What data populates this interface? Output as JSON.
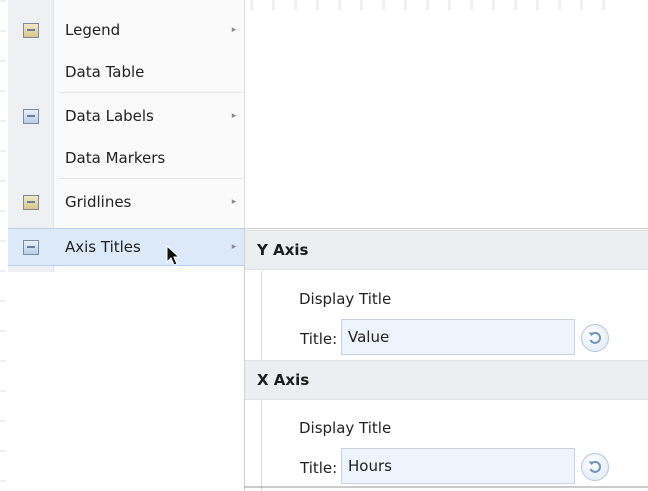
{
  "menu": {
    "items": [
      {
        "label": "Legend",
        "icon": "legend-icon",
        "has_submenu": true
      },
      {
        "label": "Data Table",
        "icon": "",
        "has_submenu": false
      },
      {
        "label": "Data Labels",
        "icon": "data-labels-icon",
        "has_submenu": true
      },
      {
        "label": "Data Markers",
        "icon": "",
        "has_submenu": false
      },
      {
        "label": "Gridlines",
        "icon": "gridlines-icon",
        "has_submenu": true
      },
      {
        "label": "Axis Titles",
        "icon": "axis-titles-icon",
        "has_submenu": true,
        "active": true
      }
    ],
    "submenu_arrow": "▸"
  },
  "axis_titles_panel": {
    "y_axis": {
      "header": "Y Axis",
      "display_title_label": "Display Title",
      "title_label": "Title:",
      "title_value": "Value"
    },
    "x_axis": {
      "header": "X Axis",
      "display_title_label": "Display Title",
      "title_label": "Title:",
      "title_value": "Hours"
    },
    "reset_icon": "undo-icon"
  },
  "colors": {
    "active_item_bg": "#dbe9f8",
    "section_header_bg": "#eceef1",
    "input_bg": "#eef4fb"
  }
}
